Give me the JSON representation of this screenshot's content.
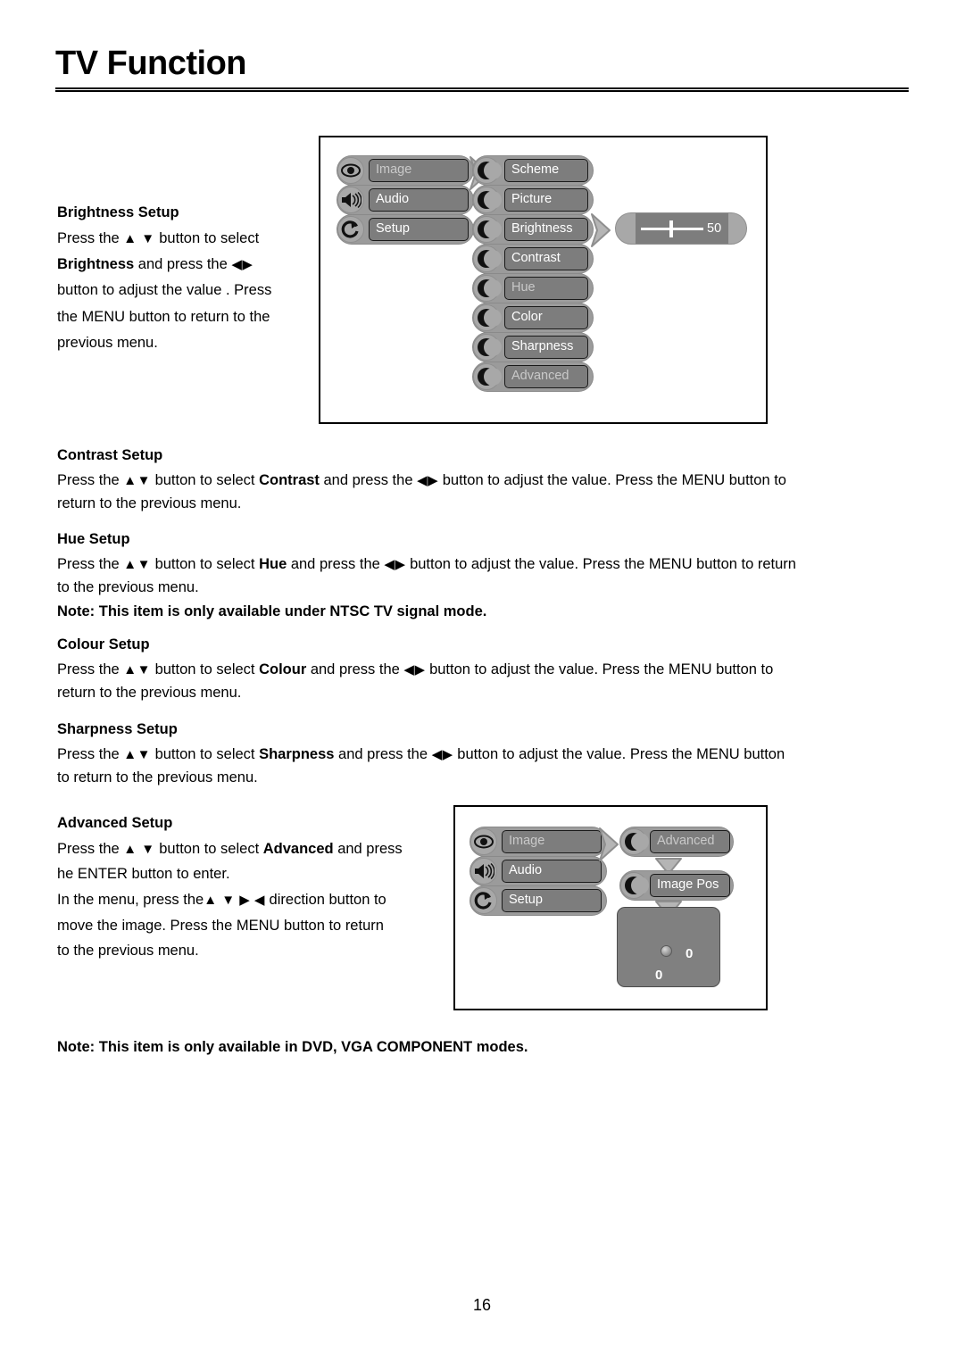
{
  "page": {
    "title": "TV Function",
    "number": "16"
  },
  "sections": {
    "brightness": {
      "heading": "Brightness Setup",
      "line1_pre": "Press the ",
      "line1_arrows": "▲ ▼",
      "line1_post": " button to select",
      "line2_bold": "Brightness",
      "line2_mid": " and press the ",
      "line2_arrows": "◀▶",
      "line3": "button to adjust the value . Press",
      "line4": "the MENU button to return to the",
      "line5": "previous menu."
    },
    "contrast": {
      "heading": "Contrast Setup",
      "body_pre": "Press the ",
      "arrows_ud": "▲▼",
      "body_mid1": " button to select ",
      "target": "Contrast",
      "body_mid2": " and press the ",
      "arrows_lr": "◀▶",
      "body_post": " button to adjust the value. Press the MENU button to return to the previous menu."
    },
    "hue": {
      "heading": "Hue Setup",
      "body_pre": "Press the ",
      "arrows_ud": "▲▼",
      "body_mid1": " button to select ",
      "target": "Hue",
      "body_mid2": " and press the ",
      "arrows_lr": "◀▶",
      "body_post": " button to adjust the value. Press the MENU button to return to the previous menu.",
      "note": "Note: This item is only available under NTSC TV signal mode."
    },
    "colour": {
      "heading": "Colour Setup",
      "body_pre": "Press the ",
      "arrows_ud": "▲▼",
      "body_mid1": " button to select ",
      "target": "Colour",
      "body_mid2": " and press the ",
      "arrows_lr": "◀▶",
      "body_post": " button to adjust the value. Press the MENU button to return to the previous menu."
    },
    "sharpness": {
      "heading": "Sharpness Setup",
      "body_pre": "Press the ",
      "arrows_ud": "▲▼",
      "body_mid1": " button to select ",
      "target": "Sharpness",
      "body_mid2": " and press the ",
      "arrows_lr": "◀▶",
      "body_post": " button to adjust the value. Press the MENU button to return to the previous menu."
    },
    "advanced": {
      "heading": "Advanced Setup",
      "line1_pre": "Press the ",
      "line1_arrows": "▲ ▼",
      "line1_mid": " button to select ",
      "line1_bold": "Advanced",
      "line1_post": " and press",
      "line2": "he ENTER button to enter.",
      "line3_pre": "In the menu, press the",
      "line3_arrows": "▲ ▼ ▶ ◀",
      "line3_post": " direction button to",
      "line4": "move the image. Press the MENU button to return",
      "line5": "to the previous menu."
    },
    "final_note": "Note: This item is only available in DVD, VGA COMPONENT modes."
  },
  "diagram_image_menu": {
    "root_items": [
      {
        "label": "Image",
        "icon": "eye-icon",
        "dim": true
      },
      {
        "label": "Audio",
        "icon": "speaker-icon",
        "dim": false
      },
      {
        "label": "Setup",
        "icon": "refresh-icon",
        "dim": false
      }
    ],
    "sub_items": [
      {
        "label": "Scheme",
        "icon": "crescent-icon",
        "dim": false
      },
      {
        "label": "Picture",
        "icon": "crescent-icon",
        "dim": false
      },
      {
        "label": "Brightness",
        "icon": "crescent-icon",
        "dim": false
      },
      {
        "label": "Contrast",
        "icon": "crescent-icon",
        "dim": false
      },
      {
        "label": "Hue",
        "icon": "crescent-icon",
        "dim": true
      },
      {
        "label": "Color",
        "icon": "crescent-icon",
        "dim": false
      },
      {
        "label": "Sharpness",
        "icon": "crescent-icon",
        "dim": false
      },
      {
        "label": "Advanced",
        "icon": "crescent-icon",
        "dim": true
      }
    ],
    "slider": {
      "value": "50"
    }
  },
  "diagram_advanced": {
    "root_items": [
      {
        "label": "Image",
        "icon": "eye-icon",
        "dim": true
      },
      {
        "label": "Audio",
        "icon": "speaker-icon",
        "dim": false
      },
      {
        "label": "Setup",
        "icon": "refresh-icon",
        "dim": false
      }
    ],
    "sub_items": [
      {
        "label": "Advanced",
        "icon": "crescent-icon",
        "dim": true
      },
      {
        "label": "Image Pos",
        "icon": "crescent-icon",
        "dim": false
      }
    ],
    "position_panel": {
      "value_x": "0",
      "value_y": "0"
    }
  },
  "colors": {
    "pill": "#9b9b9b",
    "button": "#7d7d7d",
    "knob": "#a8a8a8",
    "panel": "#808080",
    "text_on_button": "#ffffff"
  }
}
